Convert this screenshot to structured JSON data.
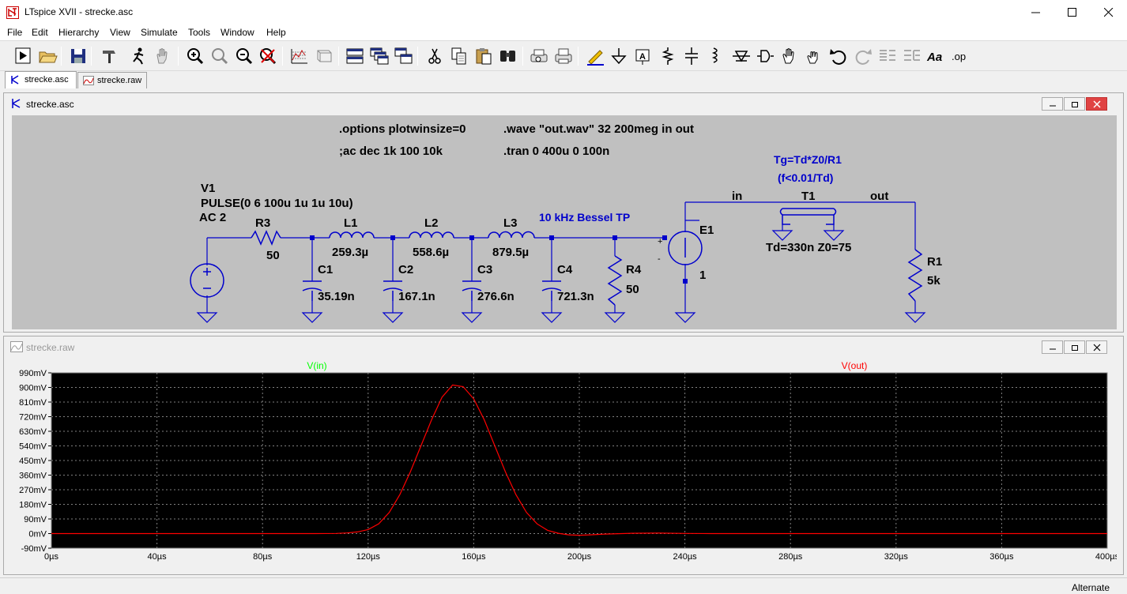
{
  "window": {
    "title": "LTspice XVII - strecke.asc"
  },
  "menu": [
    "File",
    "Edit",
    "Hierarchy",
    "View",
    "Simulate",
    "Tools",
    "Window",
    "Help"
  ],
  "toolbar": {
    "buttons": [
      "run-icon",
      "open-icon",
      "save-icon",
      "control-panel-icon",
      "halt-icon",
      "pan-icon",
      "zoom-in-icon",
      "zoom-full-icon",
      "zoom-out-icon",
      "zoom-cancel-icon",
      "autorange-icon",
      "view-waveform-icon",
      "tile-horizontal-icon",
      "cascade-icon",
      "tile-vertical-icon",
      "cut-icon",
      "copy-icon",
      "paste-icon",
      "find-icon",
      "print-preview-icon",
      "print-icon",
      "wire-icon",
      "ground-icon",
      "label-net-icon",
      "resistor-icon",
      "capacitor-icon",
      "inductor-icon",
      "diode-icon",
      "component-icon",
      "move-icon",
      "drag-icon",
      "undo-icon",
      "redo-icon",
      "rotate-icon",
      "mirror-icon",
      "text-icon",
      "spice-directive-icon"
    ],
    "text_label": "Aa",
    "op_label": ".op"
  },
  "tabs": [
    {
      "label": "strecke.asc",
      "active": true
    },
    {
      "label": "strecke.raw",
      "active": false
    }
  ],
  "schematic": {
    "title": "strecke.asc",
    "directives": {
      "options": ".options plotwinsize=0",
      "wave": ".wave \"out.wav\" 32 200meg in out",
      "ac": ";ac dec 1k 100 10k",
      "tran": ".tran 0 400u 0 100n"
    },
    "comments": {
      "filter": "10 kHz Bessel TP",
      "tg_formula": "Tg=Td*Z0/R1",
      "tg_condition": "(f<0.01/Td)"
    },
    "source": {
      "name": "V1",
      "value": "PULSE(0 6 100u 1u 1u 10u)",
      "ac": "AC 2"
    },
    "components": [
      {
        "name": "R3",
        "value": "50"
      },
      {
        "name": "L1",
        "value": "259.3µ"
      },
      {
        "name": "L2",
        "value": "558.6µ"
      },
      {
        "name": "L3",
        "value": "879.5µ"
      },
      {
        "name": "C1",
        "value": "35.19n"
      },
      {
        "name": "C2",
        "value": "167.1n"
      },
      {
        "name": "C3",
        "value": "276.6n"
      },
      {
        "name": "C4",
        "value": "721.3n"
      },
      {
        "name": "R4",
        "value": "50"
      },
      {
        "name": "E1",
        "value": "1"
      },
      {
        "name": "T1",
        "value": "Td=330n Z0=75"
      },
      {
        "name": "R1",
        "value": "5k"
      }
    ],
    "nets": {
      "in": "in",
      "out": "out"
    },
    "pins": {
      "plus": "+",
      "minus": "-"
    }
  },
  "waveform": {
    "title": "strecke.raw",
    "chart_data": {
      "type": "line",
      "xlabel": "",
      "ylabel": "",
      "xlim": [
        0,
        400
      ],
      "ylim": [
        -90,
        990
      ],
      "xticks": [
        "0µs",
        "40µs",
        "80µs",
        "120µs",
        "160µs",
        "200µs",
        "240µs",
        "280µs",
        "320µs",
        "360µs",
        "400µs"
      ],
      "yticks": [
        "990mV",
        "900mV",
        "810mV",
        "720mV",
        "630mV",
        "540mV",
        "450mV",
        "360mV",
        "270mV",
        "180mV",
        "90mV",
        "0mV",
        "-90mV"
      ],
      "series": [
        {
          "name": "V(in)",
          "color": "#00ff00",
          "x": [],
          "y": []
        },
        {
          "name": "V(out)",
          "color": "#ff0000",
          "x": [
            0,
            100,
            108,
            112,
            116,
            120,
            124,
            128,
            132,
            136,
            140,
            144,
            148,
            152,
            156,
            160,
            164,
            168,
            172,
            176,
            180,
            184,
            188,
            192,
            196,
            200,
            204,
            210,
            220,
            230,
            240,
            250,
            400
          ],
          "y": [
            0,
            0,
            1,
            4,
            10,
            25,
            60,
            130,
            240,
            380,
            540,
            700,
            840,
            915,
            905,
            830,
            700,
            540,
            380,
            240,
            130,
            60,
            20,
            2,
            -8,
            -10,
            -8,
            -3,
            2,
            3,
            1,
            0,
            0
          ]
        }
      ],
      "grid": true,
      "legend": "top"
    }
  },
  "status": {
    "text": "Alternate"
  },
  "colors": {
    "schematic_bg": "#c0c0c0",
    "wire": "#0000cc",
    "plot_bg": "#000000",
    "grid": "#808080"
  }
}
